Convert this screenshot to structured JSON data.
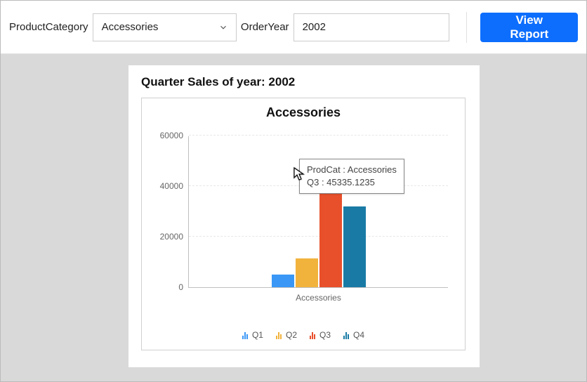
{
  "toolbar": {
    "category_label": "ProductCategory",
    "category_value": "Accessories",
    "year_label": "OrderYear",
    "year_value": "2002",
    "view_button": "View Report"
  },
  "report": {
    "title": "Quarter Sales of year: 2002",
    "tooltip_line1": "ProdCat : Accessories",
    "tooltip_line2": "Q3 : 45335.1235"
  },
  "chart_data": {
    "type": "bar",
    "title": "Accessories",
    "xlabel": "Accessories",
    "ylabel": "",
    "categories": [
      "Accessories"
    ],
    "series": [
      {
        "name": "Q1",
        "values": [
          5000
        ],
        "color": "#3a97f6"
      },
      {
        "name": "Q2",
        "values": [
          11500
        ],
        "color": "#f2b33d"
      },
      {
        "name": "Q3",
        "values": [
          45335.1235
        ],
        "color": "#e8502b"
      },
      {
        "name": "Q4",
        "values": [
          32000
        ],
        "color": "#197ba5"
      }
    ],
    "ylim": [
      0,
      60000
    ],
    "yticks": [
      0,
      20000,
      40000,
      60000
    ]
  }
}
